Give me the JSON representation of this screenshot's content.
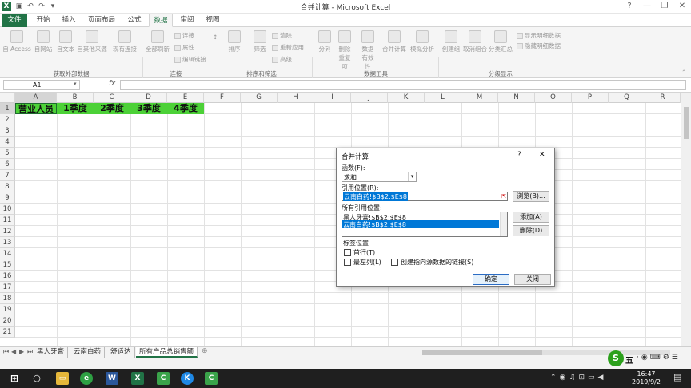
{
  "window": {
    "title": "合并计算 - Microsoft Excel",
    "buttons": [
      "?",
      "—",
      "❐",
      "✕"
    ]
  },
  "ribbon_tabs": [
    "文件",
    "开始",
    "插入",
    "页面布局",
    "公式",
    "数据",
    "审阅",
    "视图"
  ],
  "ribbon": {
    "groups": [
      "获取外部数据",
      "连接",
      "排序和筛选",
      "数据工具",
      "分级显示"
    ],
    "get_external": [
      "自 Access",
      "自网站",
      "自文本",
      "自其他来源",
      "现有连接"
    ],
    "refresh_all": "全部刷新",
    "connections": [
      "连接",
      "属性",
      "编辑链接"
    ],
    "sort_filter": [
      "排序",
      "筛选"
    ],
    "filter_small": [
      "清除",
      "重新应用",
      "高级"
    ],
    "data_tools": [
      "分列",
      "删除重复项",
      "数据有效性",
      "合并计算",
      "模拟分析"
    ],
    "outline": [
      "创建组",
      "取消组合",
      "分类汇总"
    ],
    "outline_small": [
      "显示明细数据",
      "隐藏明细数据"
    ]
  },
  "formula_bar": {
    "name_box": "A1",
    "fx": "fx"
  },
  "columns": [
    "A",
    "B",
    "C",
    "D",
    "E",
    "F",
    "G",
    "H",
    "I",
    "J",
    "K",
    "L",
    "M",
    "N",
    "O",
    "P",
    "Q",
    "R"
  ],
  "rows": [
    "1",
    "2",
    "3",
    "4",
    "5",
    "6",
    "7",
    "8",
    "9",
    "10",
    "11",
    "12",
    "13",
    "14",
    "15",
    "16",
    "17",
    "18",
    "19",
    "20",
    "21"
  ],
  "row1": [
    "营业人员",
    "1季度",
    "2季度",
    "3季度",
    "4季度"
  ],
  "sheets": [
    "黑人牙膏",
    "云南白药",
    "舒适达",
    "所有产品总销售额"
  ],
  "active_sheet": 3,
  "dialog": {
    "title": "合并计算",
    "help": "?",
    "close": "✕",
    "function_label": "函数(F):",
    "function_value": "求和",
    "ref_label": "引用位置(R):",
    "ref_value": "云南白药!$B$2:$E$8",
    "browse": "浏览(B)...",
    "all_refs_label": "所有引用位置:",
    "all_refs": [
      "黑人牙膏!$B$2:$E$8",
      "云南白药!$B$2:$E$8"
    ],
    "add": "添加(A)",
    "delete": "删除(D)",
    "labels_group": "标签位置",
    "top_row": "首行(T)",
    "left_column": "最左列(L)",
    "link_source": "创建指向源数据的链接(S)",
    "ok": "确定",
    "cancel": "关闭"
  },
  "tray": {
    "time": "16:47",
    "date": "2019/9/2",
    "ime": "五"
  },
  "colors": {
    "excel_green": "#217346",
    "header_fill": "#4cd137",
    "selection": "#0078d7"
  }
}
